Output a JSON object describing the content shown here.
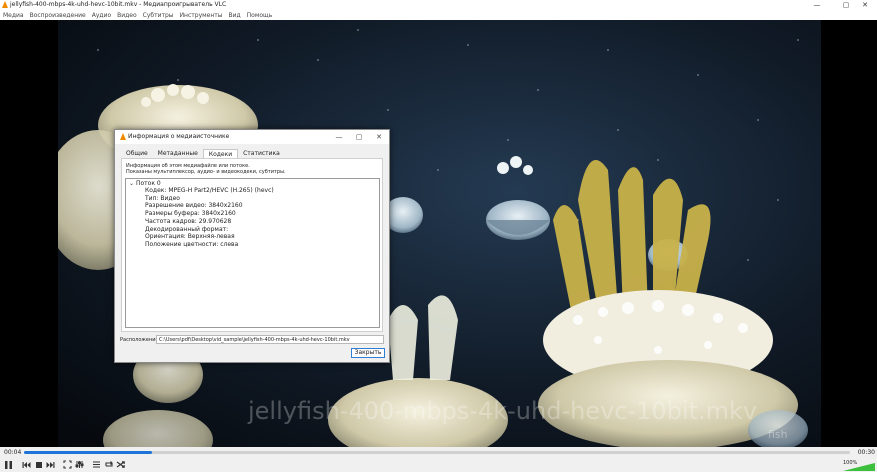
{
  "window": {
    "title": "jellyfish-400-mbps-4k-uhd-hevc-10bit.mkv - Медиапроигрыватель VLC",
    "minimize": "—",
    "maximize": "▢",
    "close": "✕"
  },
  "menu": [
    "Медиа",
    "Воспроизведение",
    "Аудио",
    "Видео",
    "Субтитры",
    "Инструменты",
    "Вид",
    "Помощь"
  ],
  "video": {
    "osd_title": "jellyfish-400-mbps-4k-uhd-hevc-10bit.mkv",
    "watermark": "fish"
  },
  "playback": {
    "elapsed": "00:04",
    "total": "00:30",
    "progress_fraction": 0.155
  },
  "controls": [
    "pause-icon",
    "previous-icon",
    "stop-icon",
    "next-icon",
    "fullscreen-icon",
    "extended-settings-icon",
    "playlist-icon",
    "loop-icon",
    "shuffle-icon"
  ],
  "volume": {
    "label": "100%",
    "level_fraction": 1.0,
    "color": "#3cbf3c"
  },
  "dialog": {
    "title": "Информация о медиаисточнике",
    "tabs": [
      {
        "label": "Общие",
        "active": false
      },
      {
        "label": "Метаданные",
        "active": false
      },
      {
        "label": "Кодеки",
        "active": true
      },
      {
        "label": "Статистика",
        "active": false
      }
    ],
    "description_line1": "Информация об этом медиафайле или потоке.",
    "description_line2": "Показаны мультиплексор, аудио- и видеокодеки, субтитры.",
    "tree_root": "Поток 0",
    "tree_items": [
      "Кодек: MPEG-H Part2/HEVC (H.265) (hevc)",
      "Тип: Видео",
      "Разрешение видео: 3840x2160",
      "Размеры буфера: 3840x2160",
      "Частота кадров: 29.970628",
      "Декодированный формат:",
      "Ориентация: Верхняя-левая",
      "Положение цветности: слева"
    ],
    "location_label": "Расположение:",
    "location_value": "C:\\Users\\pdf\\Desktop\\vid_sample\\jellyfish-400-mbps-4k-uhd-hevc-10bit.mkv",
    "close_label": "Закрыть"
  },
  "colors": {
    "accent": "#1e74d8",
    "vlc_orange": "#f08a00"
  }
}
